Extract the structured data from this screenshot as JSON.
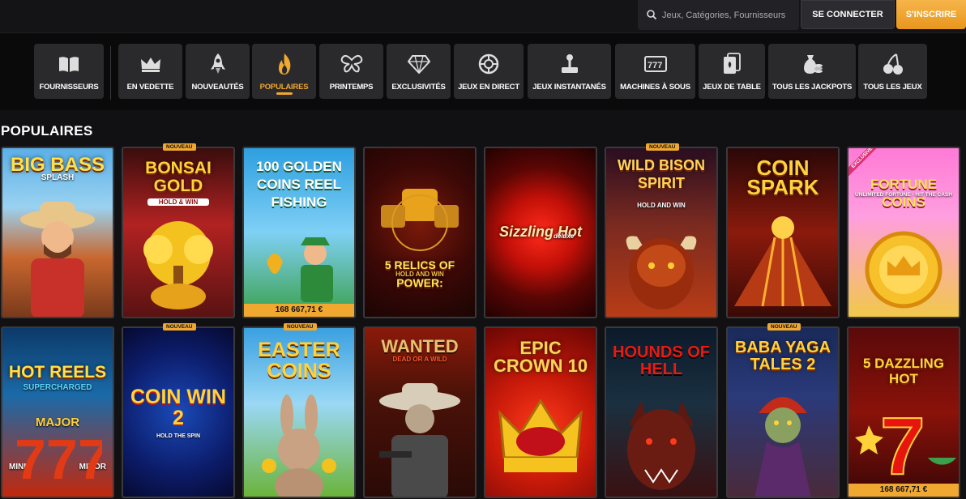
{
  "header": {
    "search_placeholder": "Jeux, Catégories, Fournisseurs",
    "login_label": "SE CONNECTER",
    "signup_label": "S'INSCRIRE",
    "accent": "#f0a830"
  },
  "nav": {
    "providers": {
      "label": "FOURNISSEURS",
      "icon": "book-icon"
    },
    "categories": [
      {
        "label": "EN VEDETTE",
        "icon": "crown-icon"
      },
      {
        "label": "NOUVEAUTÉS",
        "icon": "rocket-icon"
      },
      {
        "label": "POPULAIRES",
        "icon": "flame-icon",
        "active": true
      },
      {
        "label": "PRINTEMPS",
        "icon": "butterfly-icon"
      },
      {
        "label": "EXCLUSIVITÉS",
        "icon": "diamond-icon"
      },
      {
        "label": "JEUX EN DIRECT",
        "icon": "roulette-icon"
      },
      {
        "label": "JEUX INSTANTANÉS",
        "icon": "joystick-icon"
      },
      {
        "label": "MACHINES À SOUS",
        "icon": "slot-machine-icon"
      },
      {
        "label": "JEUX DE TABLE",
        "icon": "cards-icon"
      },
      {
        "label": "TOUS LES JACKPOTS",
        "icon": "coins-bag-icon"
      },
      {
        "label": "TOUS LES JEUX",
        "icon": "cherries-icon"
      }
    ]
  },
  "section": {
    "title": "POPULAIRES"
  },
  "badges": {
    "new": "NOUVEAU",
    "exclusive": "EXCLUSIVE"
  },
  "games": [
    {
      "name": "BIG BASS",
      "sub": "SPLASH"
    },
    {
      "name": "BONSAI GOLD",
      "sub": "HOLD & WIN",
      "badge": "NOUVEAU"
    },
    {
      "name": "100 GOLDEN COINS REEL FISHING",
      "jackpot": "168 667,71 €"
    },
    {
      "name": "5 RELICS OF POWER:",
      "sub": "HOLD AND WIN"
    },
    {
      "name": "Sizzling Hot",
      "sub": "deluxe"
    },
    {
      "name": "WILD BISON SPIRIT",
      "sub": "HOLD AND WIN",
      "badge": "NOUVEAU"
    },
    {
      "name": "COIN SPARK"
    },
    {
      "name": "FORTUNE COINS",
      "sub": "UNLIMITED FORTUNE · HIT THE CASH",
      "ribbon": "EXCLUSIVE"
    },
    {
      "name": "HOT REELS",
      "sub": "SUPERCHARGED",
      "extra": [
        "MAJOR",
        "MINI",
        "MINOR"
      ]
    },
    {
      "name": "COIN WIN 2",
      "sub": "HOLD THE SPIN",
      "badge": "NOUVEAU"
    },
    {
      "name": "EASTER COINS",
      "badge": "NOUVEAU"
    },
    {
      "name": "WANTED",
      "sub": "DEAD OR A WILD"
    },
    {
      "name": "EPIC CROWN 10"
    },
    {
      "name": "HOUNDS OF HELL"
    },
    {
      "name": "BABA YAGA TALES 2",
      "badge": "NOUVEAU"
    },
    {
      "name": "5 DAZZLING HOT",
      "jackpot": "168 667,71 €"
    }
  ]
}
